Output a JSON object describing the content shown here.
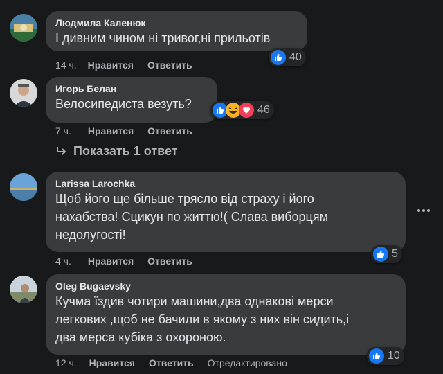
{
  "comments": [
    {
      "author": "Людмила Каленюк",
      "text": "І дивним чином ні тривог,ні прильотів",
      "time": "14 ч.",
      "like_label": "Нравится",
      "reply_label": "Ответить",
      "reaction_count": "40",
      "reactions": [
        "like"
      ]
    },
    {
      "author": "Игорь Белан",
      "text": "Велосипедиста везуть?",
      "time": "7 ч.",
      "like_label": "Нравится",
      "reply_label": "Ответить",
      "reaction_count": "46",
      "reactions": [
        "like",
        "haha",
        "love"
      ]
    },
    {
      "author": "Larissa Larochka",
      "text_lines": [
        "Щоб його ще більше трясло від страху і його",
        "нахабства! Сцикун по життю!( Слава виборцям",
        "недолугості!"
      ],
      "time": "4 ч.",
      "like_label": "Нравится",
      "reply_label": "Ответить",
      "reaction_count": "5",
      "reactions": [
        "like"
      ]
    },
    {
      "author": "Oleg Bugaevsky",
      "text_lines": [
        "Кучма їздив чотири машини,два однакові мерси",
        "легкових ,щоб не бачили в якому з них він сидить,і",
        "два мерса кубіка з охороною."
      ],
      "time": "12 ч.",
      "like_label": "Нравится",
      "reply_label": "Ответить",
      "edited_label": "Отредактировано",
      "reaction_count": "10",
      "reactions": [
        "like"
      ]
    }
  ],
  "show_replies_label": "Показать 1 ответ",
  "colors": {
    "background": "#18191a",
    "bubble": "#3a3b3c",
    "text": "#e4e6eb",
    "secondary": "#b0b3b8",
    "like_blue": "#1877f2",
    "love_red": "#f33e58",
    "haha_yellow": "#f7b125"
  }
}
